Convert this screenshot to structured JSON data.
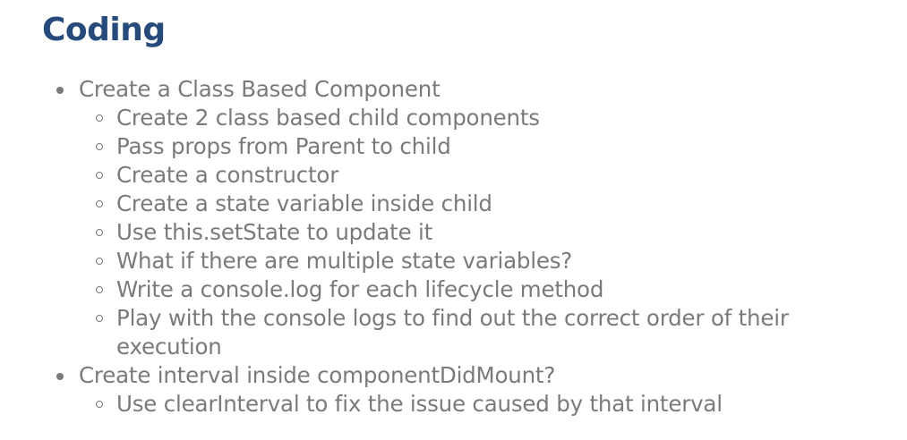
{
  "heading": "Coding",
  "items": [
    {
      "label": "Create a Class Based Component",
      "subitems": [
        "Create 2 class based child components",
        "Pass props from Parent to child",
        "Create a constructor",
        "Create a state variable inside child",
        "Use this.setState to update it",
        "What if there are multiple state variables?",
        "Write a console.log for each lifecycle method",
        "Play with the console logs to find out the correct order of their execution"
      ]
    },
    {
      "label": "Create interval inside componentDidMount?",
      "subitems": [
        "Use clearInterval to fix the issue caused by that interval"
      ]
    }
  ],
  "icons": {
    "level1_bullet": "filled-disc-bullet",
    "level2_bullet": "hollow-circle-bullet"
  },
  "colors": {
    "heading": "#264a7a",
    "text": "#7a7a7a"
  }
}
